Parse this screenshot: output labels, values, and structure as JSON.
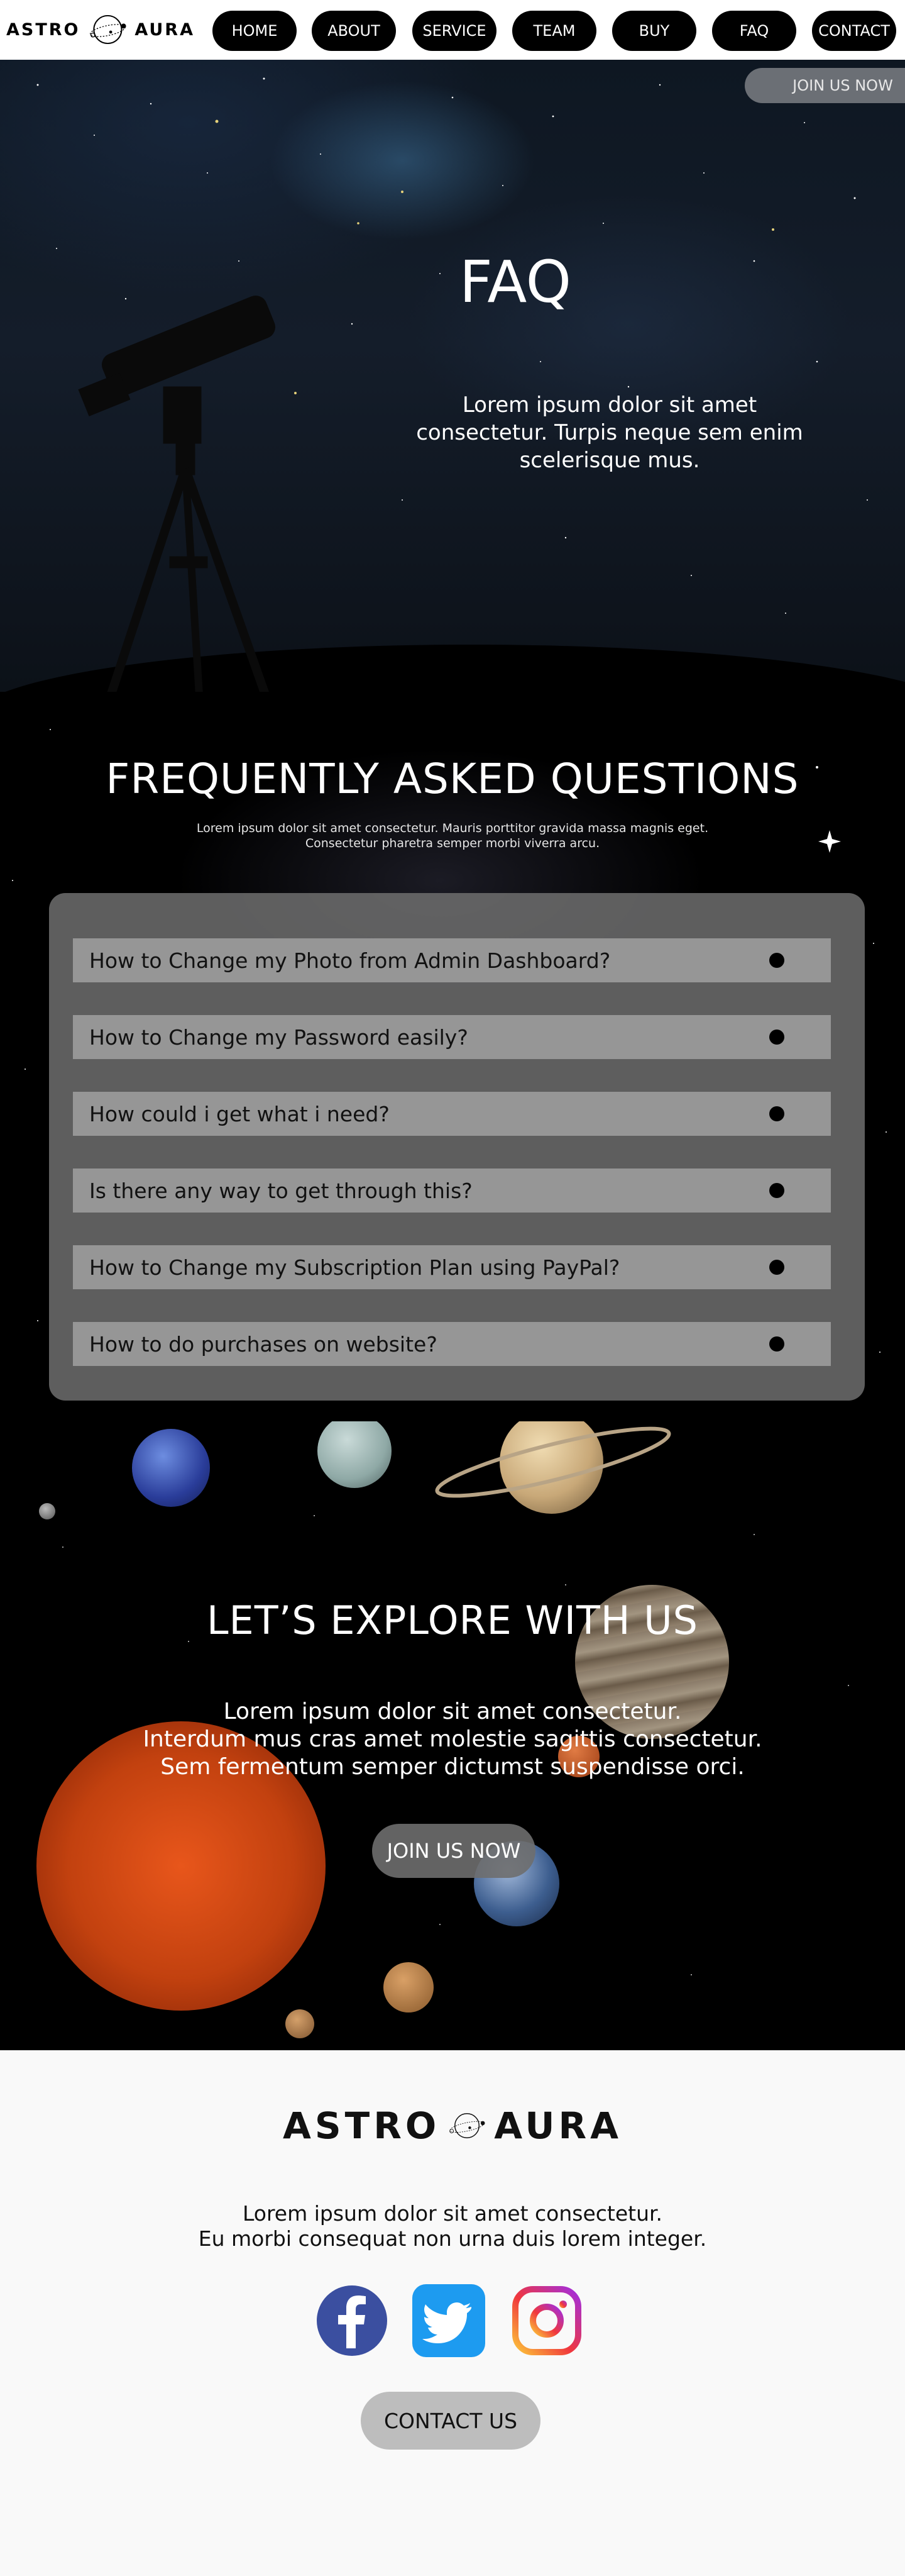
{
  "brand": {
    "word1": "ASTRO",
    "word2": "AURA"
  },
  "nav": {
    "items": [
      "HOME",
      "ABOUT",
      "SERVICE",
      "TEAM",
      "BUY",
      "FAQ",
      "CONTACT"
    ]
  },
  "hero": {
    "join_label": "JOIN US NOW",
    "title": "FAQ",
    "text": "Lorem ipsum dolor sit amet consectetur. Turpis neque sem enim scelerisque mus."
  },
  "faq": {
    "heading": "FREQUENTLY ASKED QUESTIONS",
    "subtext": "Lorem ipsum dolor sit amet consectetur. Mauris porttitor gravida massa magnis eget. Consectetur pharetra semper morbi viverra arcu.",
    "questions": [
      "How to Change my Photo from Admin Dashboard?",
      "How to Change my Password easily?",
      "How could i get what i need?",
      "Is there any way to get through this?",
      "How to Change my Subscription Plan using PayPal?",
      "How to do purchases on website?"
    ]
  },
  "explore": {
    "title": "LET’S EXPLORE WITH US",
    "line1": "Lorem ipsum dolor sit amet consectetur.",
    "line2": "Interdum mus cras amet molestie sagittis consectetur.",
    "line3": "Sem fermentum semper dictumst suspendisse orci.",
    "join_label": "JOIN US NOW"
  },
  "footer": {
    "line1": "Lorem ipsum dolor sit amet consectetur.",
    "line2": "Eu morbi consequat non urna duis lorem integer.",
    "socials": [
      "facebook-icon",
      "twitter-icon",
      "instagram-icon"
    ],
    "contact_label": "CONTACT US"
  },
  "colors": {
    "nav_bg": "#ffffff",
    "button_dark": "#000000",
    "faq_panel": "#6e6e6e",
    "faq_item": "#969696",
    "footer_bg": "#f9f9f9",
    "facebook": "#3b4fa0",
    "twitter": "#1d9bf0"
  }
}
